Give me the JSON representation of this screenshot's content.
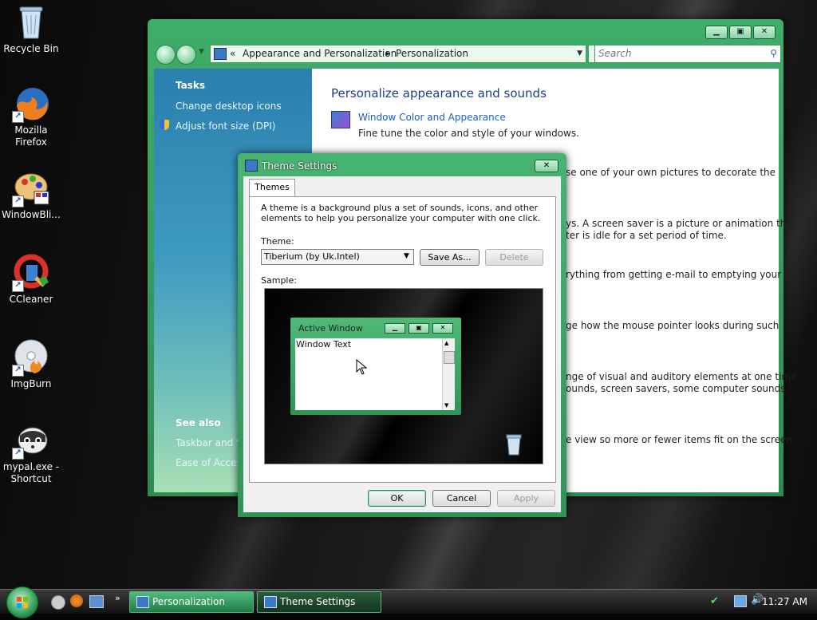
{
  "desktop": {
    "icons": [
      {
        "label": "Recycle Bin",
        "icon": "recycle-bin-icon"
      },
      {
        "label": "Mozilla Firefox",
        "icon": "firefox-icon"
      },
      {
        "label": "WindowBli...",
        "icon": "windowblinds-icon"
      },
      {
        "label": "CCleaner",
        "icon": "ccleaner-icon"
      },
      {
        "label": "ImgBurn",
        "icon": "imgburn-icon"
      },
      {
        "label": "mypal.exe - Shortcut",
        "icon": "mypal-icon"
      }
    ]
  },
  "window": {
    "breadcrumb_sep": "«",
    "breadcrumb_1": "Appearance and Personalization",
    "breadcrumb_arrow": "▸",
    "breadcrumb_2": "Personalization",
    "search_placeholder": "Search",
    "tasks_heading": "Tasks",
    "task_1": "Change desktop icons",
    "task_2": "Adjust font size (DPI)",
    "see_also_heading": "See also",
    "see_also_1": "Taskbar and St",
    "see_also_2": "Ease of Access",
    "title": "Personalize appearance and sounds",
    "item_1_link": "Window Color and Appearance",
    "item_1_desc": "Fine tune the color and style of your windows.",
    "partial_1": "se one of your own pictures to decorate the",
    "partial_2a": "ys. A screen saver is a picture or animation that",
    "partial_2b": "ter is idle for a set period of time.",
    "partial_3": "rything from getting e-mail to emptying your",
    "partial_4": "ge how the mouse pointer looks during such",
    "partial_5a": "nge of visual and auditory elements at one time",
    "partial_5b": "ounds, screen savers, some computer sounds,",
    "partial_6": "e view so more or fewer items fit on the screen."
  },
  "dialog": {
    "title": "Theme Settings",
    "tab": "Themes",
    "description_1": "A theme is a background plus a set of sounds, icons, and other",
    "description_2": "elements to help you personalize your computer with one click.",
    "theme_label": "Theme:",
    "theme_value": "Tiberium (by Uk.Intel)",
    "save_as": "Save As...",
    "delete": "Delete",
    "sample_label": "Sample:",
    "preview_title": "Active Window",
    "preview_text": "Window Text",
    "ok": "OK",
    "cancel": "Cancel",
    "apply": "Apply"
  },
  "taskbar": {
    "items": [
      {
        "label": "Personalization",
        "active": true
      },
      {
        "label": "Theme Settings",
        "active": false
      }
    ],
    "clock": "11:27 AM"
  },
  "colors": {
    "accent": "#2f9457",
    "link": "#1b5fc4",
    "title": "#1c3d8c"
  }
}
